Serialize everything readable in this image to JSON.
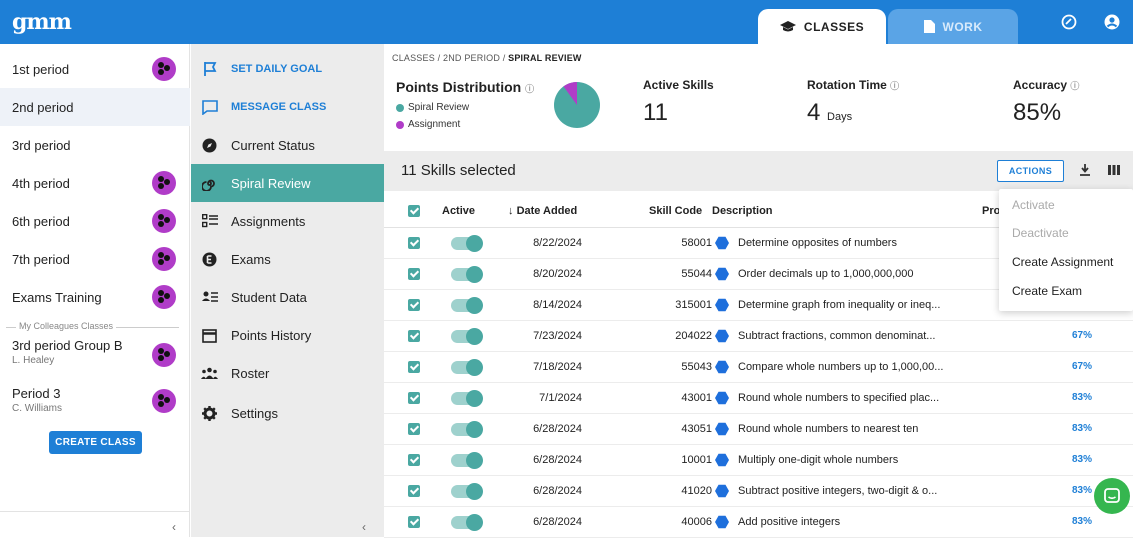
{
  "app": {
    "logo": "gmm"
  },
  "top_tabs": [
    {
      "label": "CLASSES",
      "active": true
    },
    {
      "label": "WORK",
      "active": false
    }
  ],
  "classes": [
    {
      "name": "1st period",
      "badge": true
    },
    {
      "name": "2nd period",
      "badge": false,
      "selected": true
    },
    {
      "name": "3rd period",
      "badge": false
    },
    {
      "name": "4th period",
      "badge": true
    },
    {
      "name": "6th period",
      "badge": true
    },
    {
      "name": "7th period",
      "badge": true
    },
    {
      "name": "Exams Training",
      "badge": true
    }
  ],
  "colleagues_label": "My Colleagues Classes",
  "colleague_classes": [
    {
      "name": "3rd period Group B",
      "teacher": "L. Healey"
    },
    {
      "name": "Period 3",
      "teacher": "C. Williams"
    }
  ],
  "create_class_label": "CREATE CLASS",
  "menu": [
    {
      "label": "SET DAILY GOAL",
      "icon": "flag-icon",
      "style": "blue"
    },
    {
      "label": "MESSAGE CLASS",
      "icon": "message-icon",
      "style": "blue"
    },
    {
      "label": "Current Status",
      "icon": "compass-icon"
    },
    {
      "label": "Spiral Review",
      "icon": "spiral-icon",
      "active": true
    },
    {
      "label": "Assignments",
      "icon": "list-icon"
    },
    {
      "label": "Exams",
      "icon": "exam-icon"
    },
    {
      "label": "Student Data",
      "icon": "student-data-icon"
    },
    {
      "label": "Points History",
      "icon": "calendar-icon"
    },
    {
      "label": "Roster",
      "icon": "roster-icon"
    },
    {
      "label": "Settings",
      "icon": "gear-icon"
    }
  ],
  "breadcrumb": {
    "part1": "CLASSES",
    "part2": "2ND PERIOD",
    "part3": "SPIRAL REVIEW",
    "sep": "/"
  },
  "points_distribution": {
    "title": "Points Distribution",
    "legend": [
      {
        "label": "Spiral Review",
        "color": "#4aa8a2"
      },
      {
        "label": "Assignment",
        "color": "#b03cc8"
      }
    ],
    "spiral_fraction": 0.9
  },
  "stats": {
    "active_skills": {
      "label": "Active Skills",
      "value": "11"
    },
    "rotation_time": {
      "label": "Rotation Time",
      "value": "4",
      "unit": "Days"
    },
    "accuracy": {
      "label": "Accuracy",
      "value": "85%"
    }
  },
  "toolbar": {
    "selected_text": "11 Skills selected",
    "actions_label": "ACTIONS"
  },
  "table": {
    "headers": {
      "active": "Active",
      "date_added": "Date Added",
      "skill_code": "Skill Code",
      "description": "Description",
      "progress": "Pro"
    },
    "rows": [
      {
        "date": "8/22/2024",
        "code": "58001",
        "desc": "Determine opposites of numbers",
        "pct": ""
      },
      {
        "date": "8/20/2024",
        "code": "55044",
        "desc": "Order decimals up to 1,000,000,000",
        "pct": ""
      },
      {
        "date": "8/14/2024",
        "code": "315001",
        "desc": "Determine graph from inequality or ineq...",
        "pct": ""
      },
      {
        "date": "7/23/2024",
        "code": "204022",
        "desc": "Subtract fractions, common denominat...",
        "pct": "67%"
      },
      {
        "date": "7/18/2024",
        "code": "55043",
        "desc": "Compare whole numbers up to 1,000,00...",
        "pct": "67%"
      },
      {
        "date": "7/1/2024",
        "code": "43001",
        "desc": "Round whole numbers to specified plac...",
        "pct": "83%"
      },
      {
        "date": "6/28/2024",
        "code": "43051",
        "desc": "Round whole numbers to nearest ten",
        "pct": "83%"
      },
      {
        "date": "6/28/2024",
        "code": "10001",
        "desc": "Multiply one-digit whole numbers",
        "pct": "83%"
      },
      {
        "date": "6/28/2024",
        "code": "41020",
        "desc": "Subtract positive integers, two-digit & o...",
        "pct": "83%"
      },
      {
        "date": "6/28/2024",
        "code": "40006",
        "desc": "Add positive integers",
        "pct": "83%"
      }
    ]
  },
  "actions_menu": [
    {
      "label": "Activate",
      "disabled": true
    },
    {
      "label": "Deactivate",
      "disabled": true
    },
    {
      "label": "Create Assignment",
      "disabled": false
    },
    {
      "label": "Create Exam",
      "disabled": false
    }
  ],
  "colors": {
    "primary": "#1e7fd6",
    "teal": "#4aa8a2",
    "purple": "#b03cc8"
  }
}
